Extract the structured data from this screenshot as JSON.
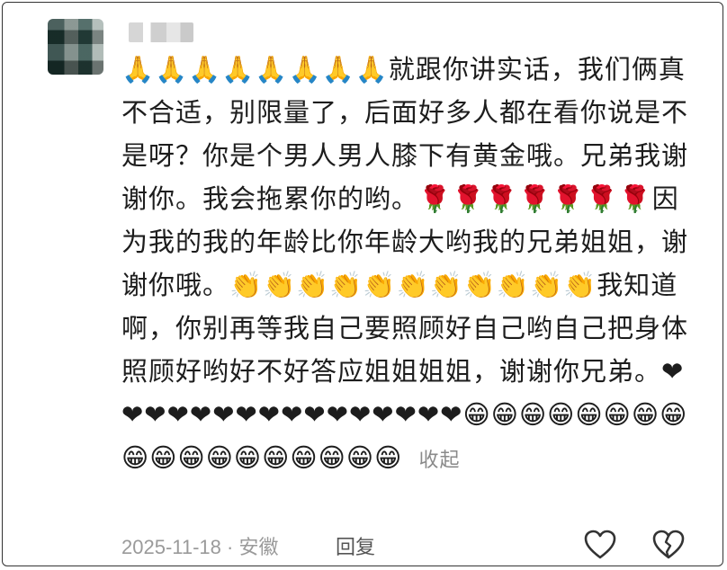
{
  "user": {
    "name": ""
  },
  "comment": {
    "text": "🙏🙏🙏🙏🙏🙏🙏🙏就跟你讲实话，我们俩真不合适，别限量了，后面好多人都在看你说是不是呀？你是个男人男人膝下有黄金哦。兄弟我谢谢你。我会拖累你的哟。🌹🌹🌹🌹🌹🌹🌹因为我的我的年龄比你年龄大哟我的兄弟姐姐，谢谢你哦。👏👏👏👏👏👏👏👏👏👏👏我知道啊，你别再等我自己要照顾好自己哟自己把身体照顾好哟好不好答应姐姐姐姐，谢谢你兄弟。❤❤❤❤❤❤❤❤❤❤❤❤❤❤❤❤😁😁😁😁😁😁😁😁😁😁😁😁😁😁😁😁😁😁",
    "collapse_label": "收起"
  },
  "meta": {
    "timestamp_location": "2025-11-18 · 安徽",
    "reply_label": "回复"
  },
  "icons": {
    "like": "heart-outline-icon",
    "dislike": "broken-heart-icon"
  }
}
